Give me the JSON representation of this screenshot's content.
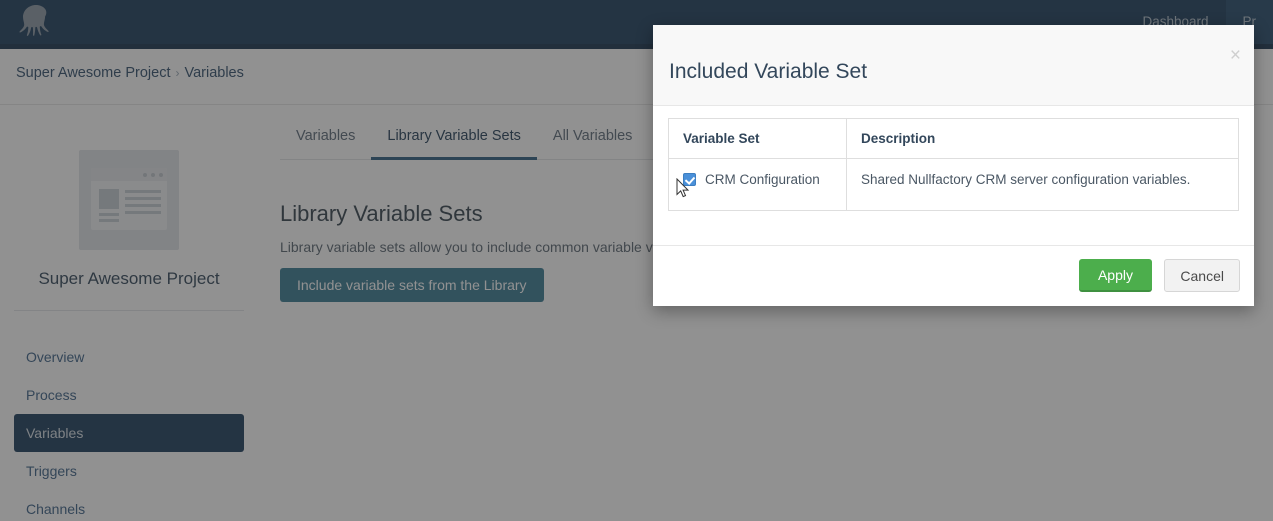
{
  "topnav": {
    "logo_icon": "octopus-logo-icon",
    "links": [
      {
        "label": "Dashboard",
        "active": false
      },
      {
        "label": "Pr",
        "active": true
      }
    ]
  },
  "breadcrumb": {
    "project": "Super Awesome Project",
    "separator": "›",
    "current": "Variables"
  },
  "project_panel": {
    "thumbnail_icon": "project-placeholder-icon",
    "name": "Super Awesome Project",
    "nav": [
      {
        "label": "Overview",
        "active": false
      },
      {
        "label": "Process",
        "active": false
      },
      {
        "label": "Variables",
        "active": true
      },
      {
        "label": "Triggers",
        "active": false
      },
      {
        "label": "Channels",
        "active": false
      }
    ]
  },
  "main": {
    "tabs": [
      {
        "label": "Variables",
        "active": false
      },
      {
        "label": "Library Variable Sets",
        "active": true
      },
      {
        "label": "All Variables",
        "active": false
      }
    ],
    "title": "Library Variable Sets",
    "description": "Library variable sets allow you to include common variable value",
    "include_button": "Include variable sets from the Library",
    "include_button_color": "#3a7b93"
  },
  "modal": {
    "title": "Included Variable Set",
    "close_icon": "close-icon",
    "table": {
      "columns": [
        "Variable Set",
        "Description"
      ],
      "rows": [
        {
          "checked": true,
          "name": "CRM Configuration",
          "description": "Shared Nullfactory CRM server configuration variables."
        }
      ]
    },
    "apply_label": "Apply",
    "cancel_label": "Cancel",
    "apply_color": "#4cae4c"
  },
  "cursor": {
    "icon": "mouse-pointer-icon"
  }
}
